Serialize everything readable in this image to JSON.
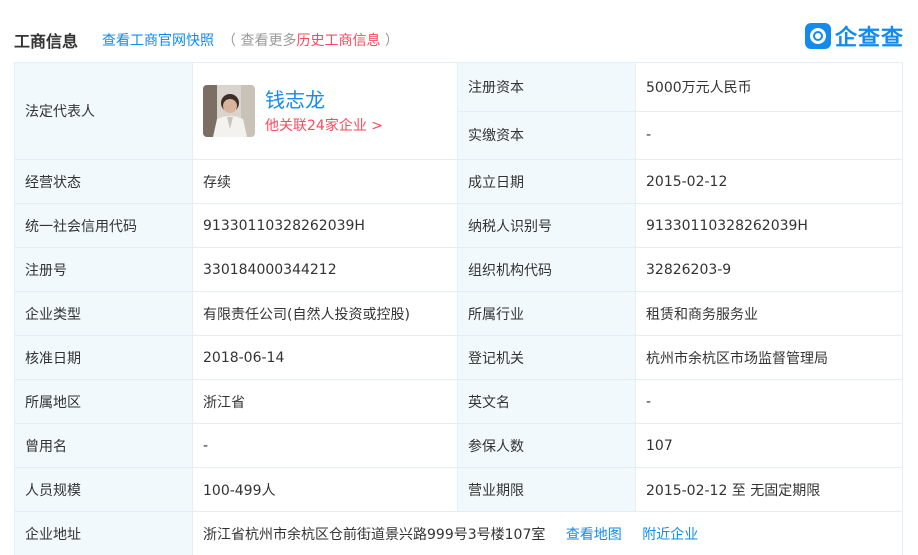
{
  "header": {
    "title": "工商信息",
    "snapshot_link": "查看工商官网快照",
    "history_prefix": "（ 查看更多",
    "history_link": "历史工商信息",
    "history_suffix": " ）",
    "logo_text": "企查查",
    "logo_icon": "qichacha-logo-icon"
  },
  "colors": {
    "accent": "#128bed",
    "highlight": "#fd485e",
    "label_bg": "#f2f9fc",
    "border": "#e4eef6"
  },
  "legal_rep": {
    "label": "法定代表人",
    "name": "钱志龙",
    "related": "他关联24家企业 >"
  },
  "capital": {
    "registered_label": "注册资本",
    "registered_value": "5000万元人民币",
    "paid_label": "实缴资本",
    "paid_value": "-"
  },
  "rows": [
    {
      "l1": "经营状态",
      "v1": "存续",
      "l2": "成立日期",
      "v2": "2015-02-12"
    },
    {
      "l1": "统一社会信用代码",
      "v1": "91330110328262039H",
      "l2": "纳税人识别号",
      "v2": "91330110328262039H"
    },
    {
      "l1": "注册号",
      "v1": "330184000344212",
      "l2": "组织机构代码",
      "v2": "32826203-9"
    },
    {
      "l1": "企业类型",
      "v1": "有限责任公司(自然人投资或控股)",
      "l2": "所属行业",
      "v2": "租赁和商务服务业"
    },
    {
      "l1": "核准日期",
      "v1": "2018-06-14",
      "l2": "登记机关",
      "v2": "杭州市余杭区市场监督管理局"
    },
    {
      "l1": "所属地区",
      "v1": "浙江省",
      "l2": "英文名",
      "v2": "-"
    },
    {
      "l1": "曾用名",
      "v1": "-",
      "l2": "参保人数",
      "v2": "107"
    },
    {
      "l1": "人员规模",
      "v1": "100-499人",
      "l2": "营业期限",
      "v2": "2015-02-12 至 无固定期限"
    }
  ],
  "address": {
    "label": "企业地址",
    "value": "浙江省杭州市余杭区仓前街道景兴路999号3号楼107室",
    "map_link": "查看地图",
    "nearby_link": "附近企业"
  }
}
